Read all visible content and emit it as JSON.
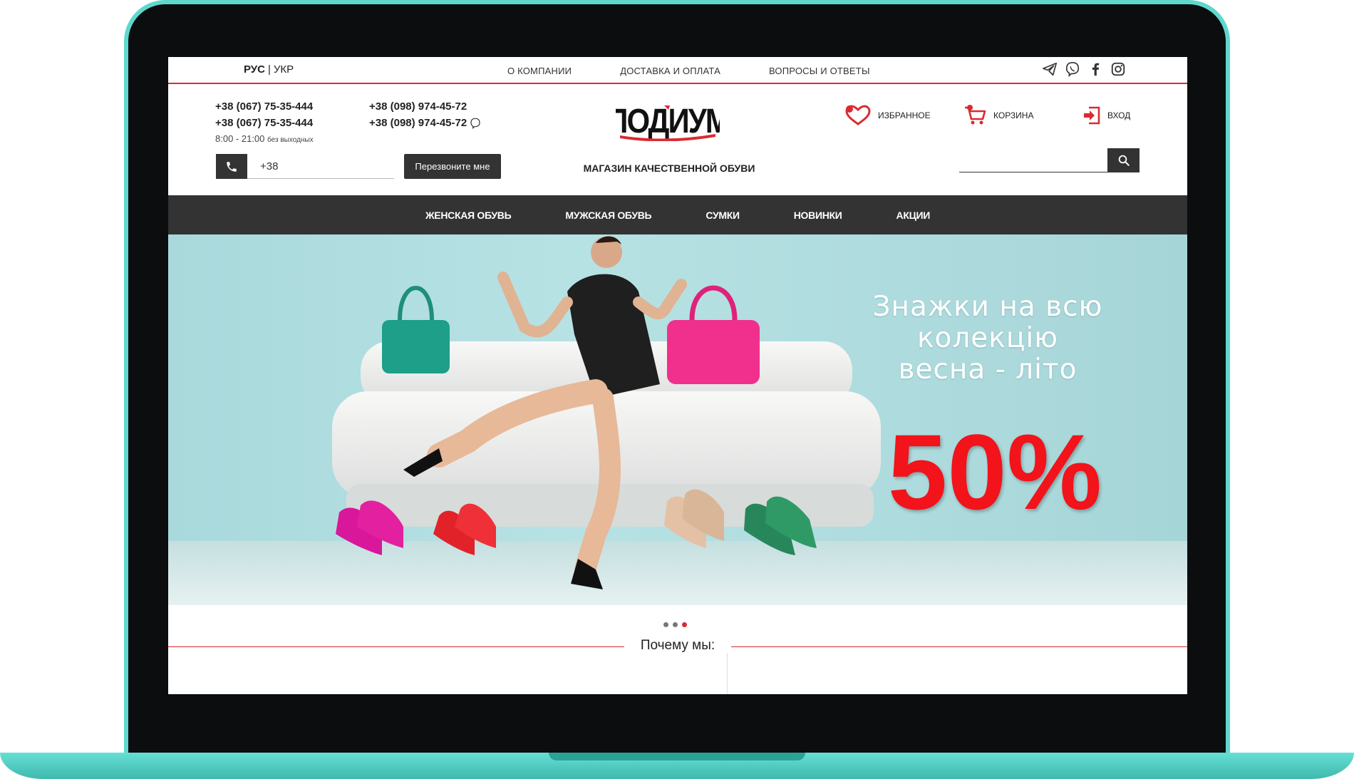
{
  "lang": {
    "active": "РУС",
    "separator": "|",
    "other": "УКР"
  },
  "top_nav": [
    "О компании",
    "Доставка и оплата",
    "Вопросы и ответы"
  ],
  "socials": [
    "telegram-icon",
    "viber-icon",
    "facebook-icon",
    "instagram-icon"
  ],
  "phones": {
    "col1": [
      "+38 (067) 75-35-444",
      "+38 (067) 75-35-444"
    ],
    "col2": [
      "+38 (098) 974-45-72",
      "+38 (098) 974-45-72"
    ],
    "hours": "8:00 - 21:00",
    "hours_note": "без выходных"
  },
  "callback": {
    "value": "+38",
    "button": "Перезвоните мне"
  },
  "logo": {
    "text": "ПОДИУМ",
    "tagline": "Магазин качественной обуви"
  },
  "header_actions": [
    "Избранное",
    "Корзина",
    "Вход"
  ],
  "search": {
    "placeholder": ""
  },
  "main_nav": [
    "Женская обувь",
    "Мужская обувь",
    "Сумки",
    "Новинки",
    "Акции"
  ],
  "banner": {
    "line1": "Знажки на всю",
    "line2": "колекцію",
    "line3": "весна - літо",
    "discount": "50%"
  },
  "slider": {
    "count": 3,
    "active": 3
  },
  "section_title": "Почему мы:",
  "colors": {
    "accent": "#d92b32",
    "dark": "#333333",
    "promo": "#f2131b",
    "frame": "#5fd8cc"
  }
}
